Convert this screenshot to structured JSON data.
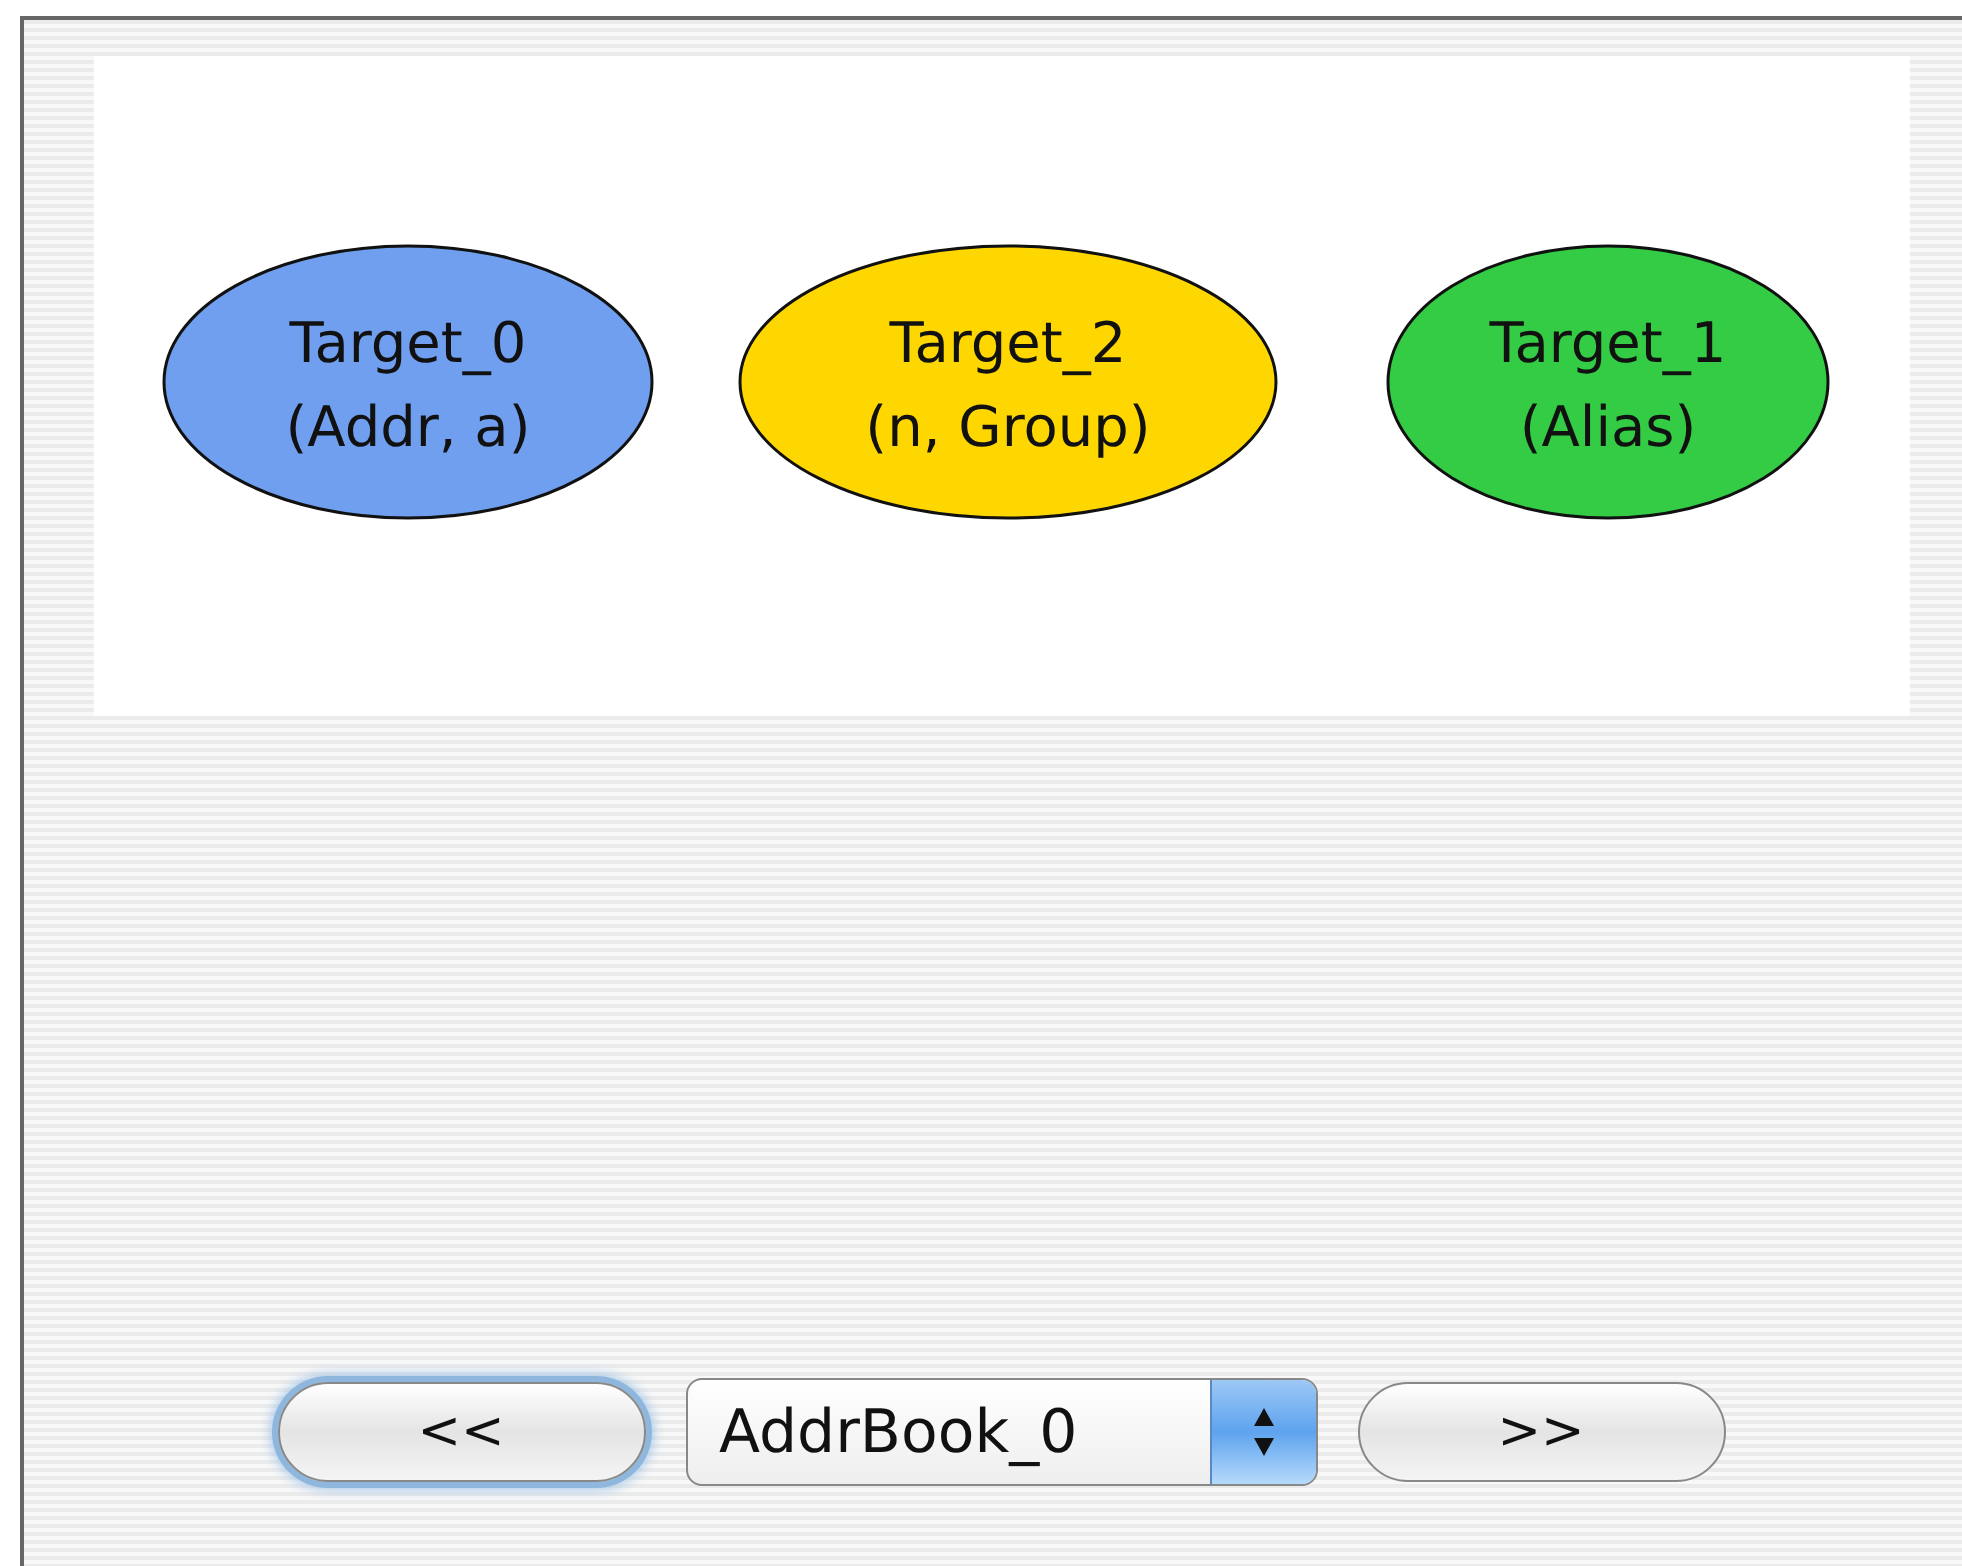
{
  "graph": {
    "nodes": [
      {
        "lines": [
          "Target_0",
          "(Addr, a)"
        ],
        "color": "#6f9fee"
      },
      {
        "lines": [
          "Target_2",
          "(n, Group)"
        ],
        "color": "#ffd700"
      },
      {
        "lines": [
          "Target_1",
          "(Alias)"
        ],
        "color": "#33cc44"
      }
    ]
  },
  "controls": {
    "previous": {
      "label": "<<",
      "focused": true
    },
    "popup": {
      "value": "AddrBook_0"
    },
    "next": {
      "label": ">>",
      "focused": false
    }
  }
}
